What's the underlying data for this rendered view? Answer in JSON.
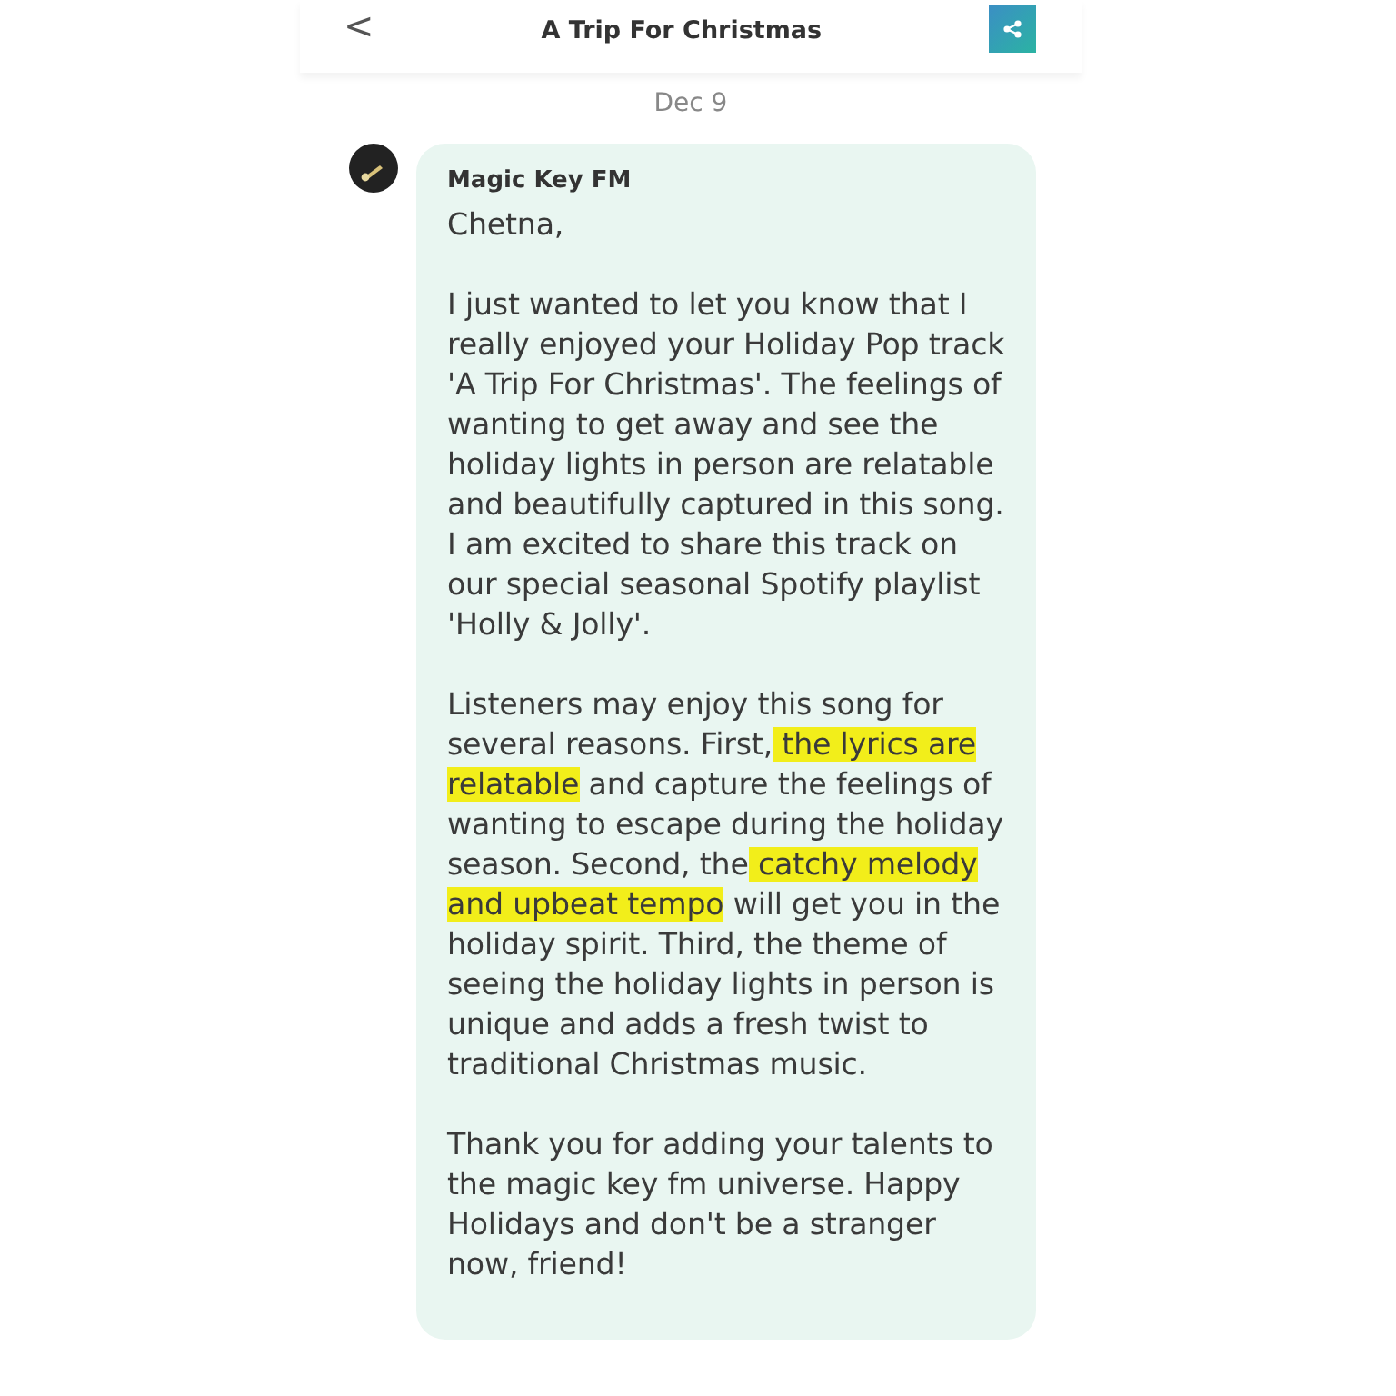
{
  "header": {
    "back": "<",
    "title": "A Trip For Christmas"
  },
  "date": "Dec 9",
  "message": {
    "sender": "Magic Key FM",
    "greeting": "Chetna,",
    "paragraphs": [
      [
        {
          "text": "I just wanted to let you know that I really enjoyed your Holiday Pop track 'A Trip For Christmas'. The feelings of wanting to get away and see the holiday lights in person are relatable and beautifully captured in this song. I am excited to share this track on our special seasonal Spotify playlist 'Holly & Jolly'.",
          "highlighted": false
        }
      ],
      [
        {
          "text": "Listeners may enjoy this song for several reasons. First,",
          "highlighted": false
        },
        {
          "text": " the lyrics are relatable",
          "highlighted": true
        },
        {
          "text": " and capture the feelings of wanting to escape during the holiday season. Second, the",
          "highlighted": false
        },
        {
          "text": " catchy melody and upbeat tempo",
          "highlighted": true
        },
        {
          "text": " will get you in the holiday spirit. Third, the theme of seeing the holiday lights in person is unique and adds a fresh twist to traditional Christmas music.",
          "highlighted": false
        }
      ],
      [
        {
          "text": "Thank you for adding your talents to the magic key fm universe. Happy Holidays and don't be a stranger now, friend!",
          "highlighted": false
        }
      ]
    ]
  }
}
